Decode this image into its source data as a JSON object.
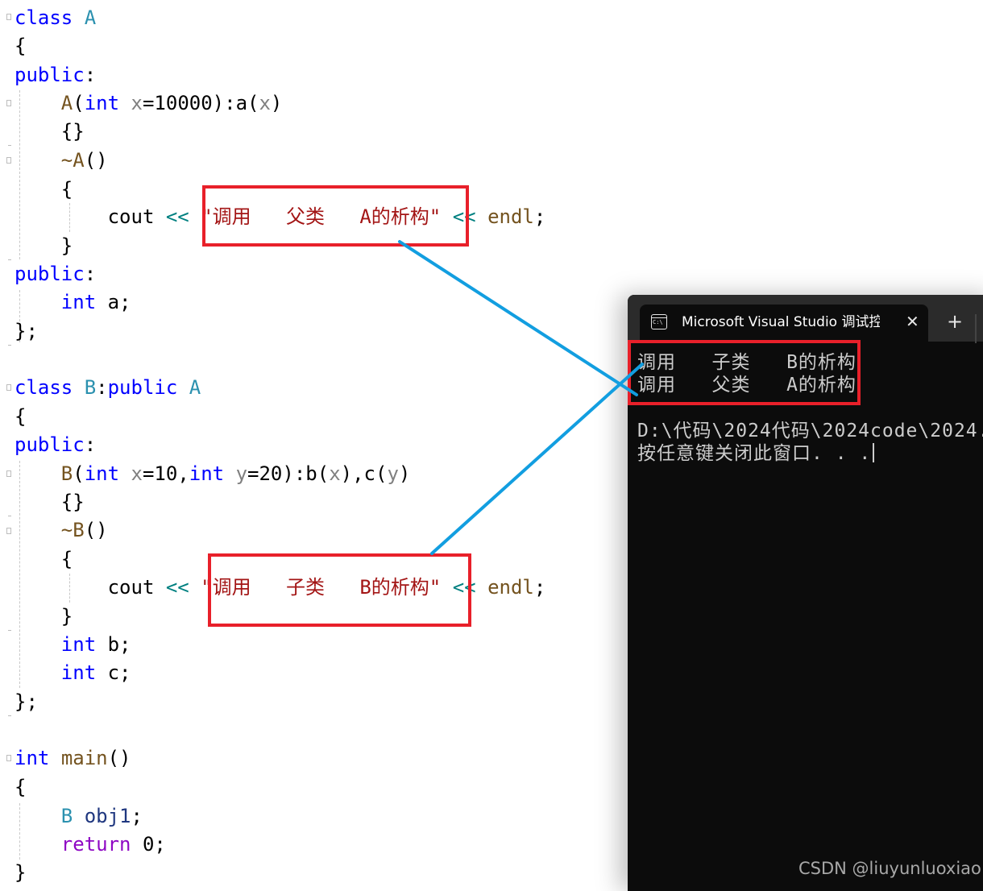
{
  "code": {
    "class_a": {
      "l1_kw": "class",
      "l1_name": "A",
      "l2": "{",
      "l3_kw": "public",
      "l3_colon": ":",
      "l4_fn": "A",
      "l4_p1": "(",
      "l4_int": "int",
      "l4_x": "x",
      "l4_rest": "=10000):a(",
      "l4_x2": "x",
      "l4_end": ")",
      "l5": "{}",
      "l6_fn": "~A",
      "l6_end": "()",
      "l7": "{",
      "l8_cout": "cout ",
      "l8_op1": "<<",
      "l8_str": "\"调用   父类   A的析构\"",
      "l8_op2": "<<",
      "l8_endl": "endl",
      "l8_semi": ";",
      "l9": "}",
      "l10_kw": "public",
      "l10_colon": ":",
      "l11_int": "int",
      "l11_rest": " a;",
      "l12": "};"
    },
    "class_b": {
      "l1_kw": "class",
      "l1_name": "B",
      "l1_colon": ":",
      "l1_public": "public",
      "l1_base": "A",
      "l2": "{",
      "l3_kw": "public",
      "l3_colon": ":",
      "l4_fn": "B",
      "l4_p1": "(",
      "l4_int": "int",
      "l4_x": "x",
      "l4_mid": "=10,",
      "l4_int2": "int",
      "l4_y": "y",
      "l4_rest": "=20):b(",
      "l4_x2": "x",
      "l4_mid2": "),c(",
      "l4_y2": "y",
      "l4_end": ")",
      "l5": "{}",
      "l6_fn": "~B",
      "l6_end": "()",
      "l7": "{",
      "l8_cout": "cout ",
      "l8_op1": "<<",
      "l8_str": "\"调用   子类   B的析构\"",
      "l8_op2": "<<",
      "l8_endl": "endl",
      "l8_semi": ";",
      "l9": "}",
      "l10_int": "int",
      "l10_rest": " b;",
      "l11_int": "int",
      "l11_rest": " c;",
      "l12": "};"
    },
    "main_fn": {
      "l1_int": "int",
      "l1_fn": "main",
      "l1_end": "()",
      "l2": "{",
      "l3_type": "B",
      "l3_var": "obj1",
      "l3_semi": ";",
      "l4_ret": "return",
      "l4_rest": " 0;",
      "l5": "}"
    }
  },
  "console": {
    "tab_title": "Microsoft Visual Studio 调试控制台",
    "tab_icon_label": "C:\\",
    "close_glyph": "✕",
    "new_tab_glyph": "+",
    "output_lines": [
      "调用   子类   B的析构",
      "调用   父类   A的析构"
    ],
    "path_line": "D:\\代码\\2024代码\\2024code\\2024.",
    "prompt_line": "按任意键关闭此窗口. . ."
  },
  "annotation_colors": {
    "highlight_box": "#e8202a",
    "connector_line": "#129ee0"
  },
  "watermark": "CSDN @liuyunluoxiao"
}
